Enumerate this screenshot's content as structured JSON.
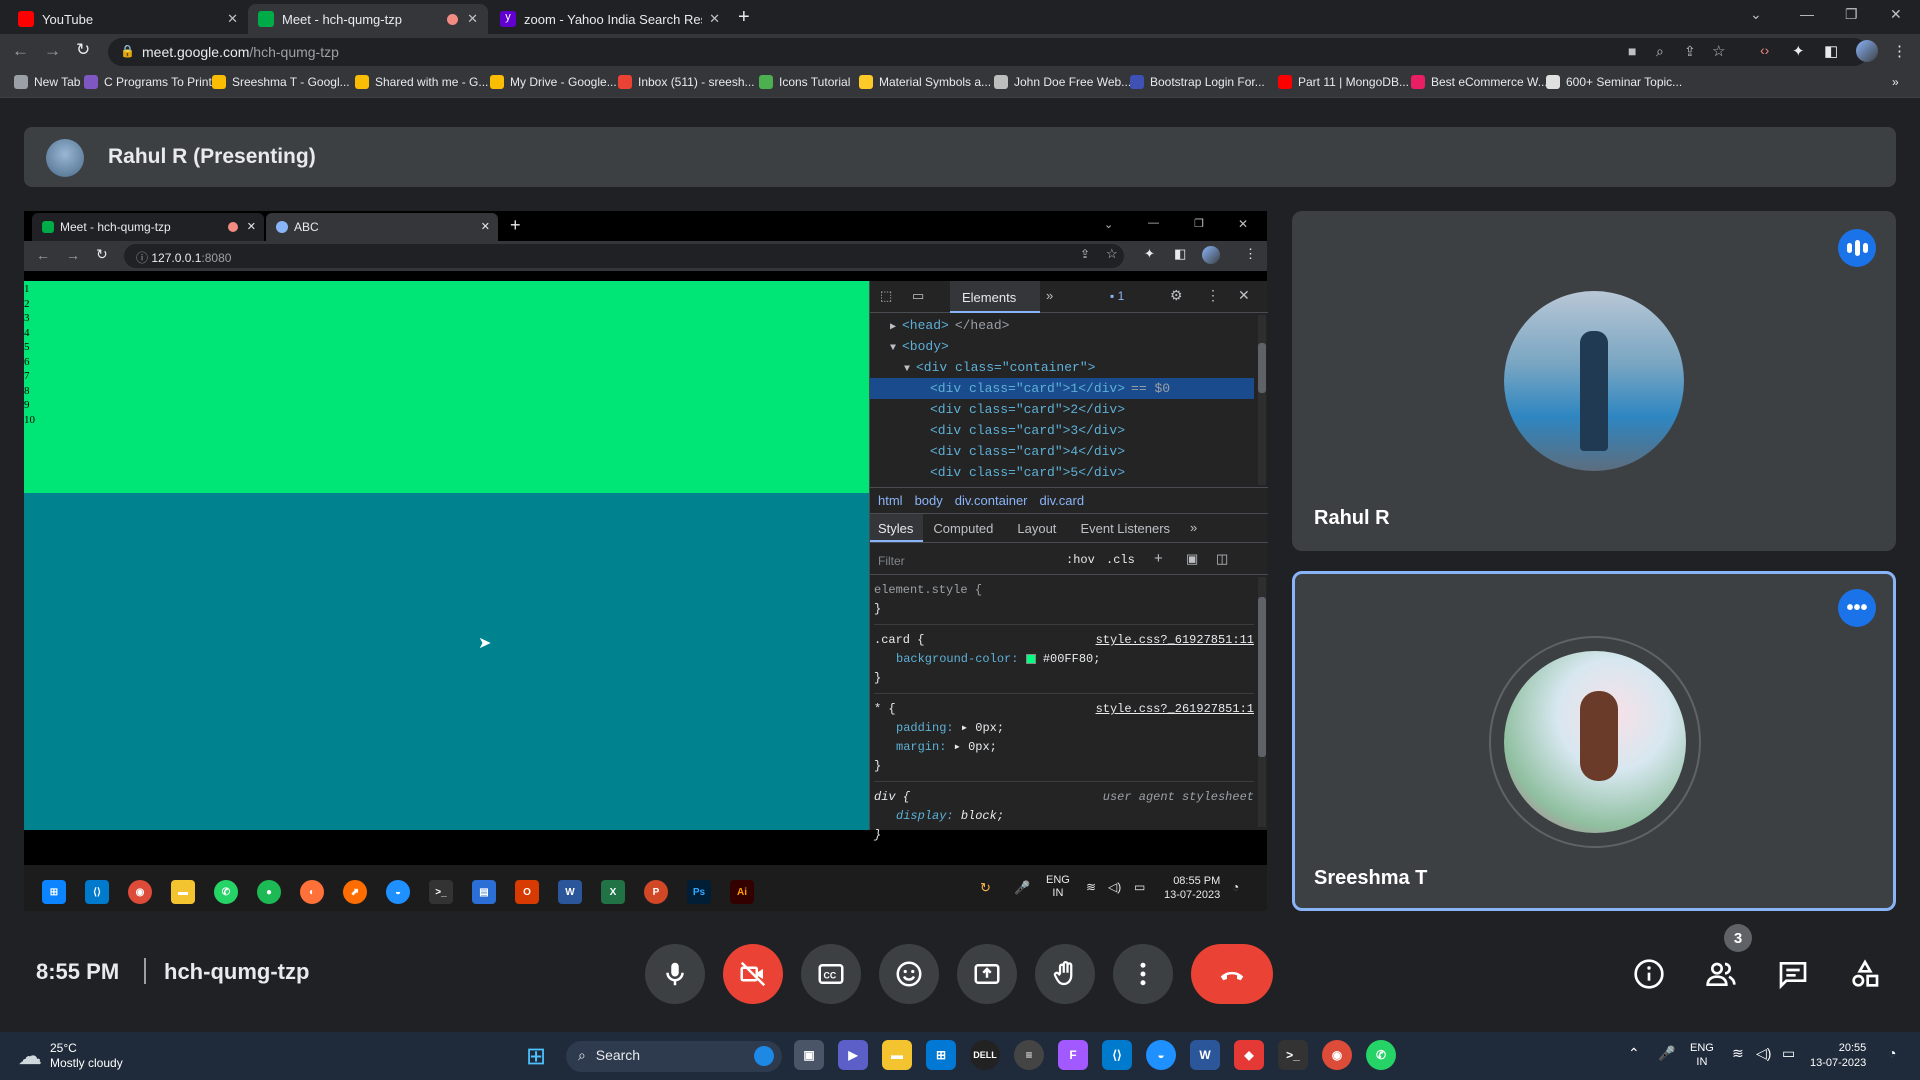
{
  "browser": {
    "tabs": [
      {
        "label": "YouTube",
        "color": "#ff0000"
      },
      {
        "label": "Meet - hch-qumg-tzp",
        "color": "#00ac47"
      },
      {
        "label": "zoom - Yahoo India Search Resul",
        "color": "#6001d2"
      }
    ],
    "url_host": "meet.google.com",
    "url_path": "/hch-qumg-tzp",
    "bookmarks": [
      {
        "label": "New Tab",
        "color": "#9aa0a6"
      },
      {
        "label": "C Programs To Print...",
        "color": "#7e57c2"
      },
      {
        "label": "Sreeshma T - Googl...",
        "color": "#fbbc04"
      },
      {
        "label": "Shared with me - G...",
        "color": "#fbbc04"
      },
      {
        "label": "My Drive - Google...",
        "color": "#fbbc04"
      },
      {
        "label": "Inbox (511) - sreesh...",
        "color": "#ea4335"
      },
      {
        "label": "Icons Tutorial",
        "color": "#4caf50"
      },
      {
        "label": "Material Symbols a...",
        "color": "#ffca28"
      },
      {
        "label": "John Doe Free Web...",
        "color": "#bdbdbd"
      },
      {
        "label": "Bootstrap Login For...",
        "color": "#3f51b5"
      },
      {
        "label": "Part 11 | MongoDB...",
        "color": "#ff0000"
      },
      {
        "label": "Best eCommerce W...",
        "color": "#e91e63"
      },
      {
        "label": "600+ Seminar Topic...",
        "color": "#e0e0e0"
      }
    ]
  },
  "meet": {
    "presenter_title": "Rahul R (Presenting)",
    "clock": "8:55 PM",
    "meeting_code": "hch-qumg-tzp",
    "participants_count": "3",
    "participants": [
      {
        "name": "Rahul R"
      },
      {
        "name": "Sreeshma T"
      }
    ]
  },
  "shared_screen": {
    "tabs": [
      {
        "label": "Meet - hch-qumg-tzp"
      },
      {
        "label": "ABC"
      }
    ],
    "url_host": "127.0.0.1",
    "url_port": ":8080",
    "page_lines": [
      "1",
      "2",
      "3",
      "4",
      "5",
      "6",
      "7",
      "8",
      "9",
      "10"
    ],
    "page_color_top": "#00e676",
    "page_color_bottom": "#00838f",
    "devtools": {
      "panel": "Elements",
      "issues": "1",
      "dom_lines": [
        {
          "indent": 0,
          "arrow": "▶",
          "text": "<head>",
          "tail": "</head>"
        },
        {
          "indent": 0,
          "arrow": "▼",
          "text": "<body>",
          "tail": ""
        },
        {
          "indent": 1,
          "arrow": "▼",
          "text": "<div class=\"container\">",
          "tail": ""
        },
        {
          "indent": 2,
          "arrow": "",
          "text": "<div class=\"card\">1</div>",
          "tail": "== $0"
        },
        {
          "indent": 2,
          "arrow": "",
          "text": "<div class=\"card\">2</div>",
          "tail": ""
        },
        {
          "indent": 2,
          "arrow": "",
          "text": "<div class=\"card\">3</div>",
          "tail": ""
        },
        {
          "indent": 2,
          "arrow": "",
          "text": "<div class=\"card\">4</div>",
          "tail": ""
        },
        {
          "indent": 2,
          "arrow": "",
          "text": "<div class=\"card\">5</div>",
          "tail": ""
        }
      ],
      "breadcrumbs": [
        "html",
        "body",
        "div.container",
        "div.card"
      ],
      "style_tabs": [
        "Styles",
        "Computed",
        "Layout",
        "Event Listeners"
      ],
      "filter_placeholder": "Filter",
      "hov": ":hov",
      "cls": ".cls",
      "rules": {
        "element_style": "element.style {",
        "card_selector": ".card {",
        "card_source": "style.css?_61927851:11",
        "card_prop": "background-color:",
        "card_value": "#00FF80;",
        "star_selector": "* {",
        "star_source": "style.css?_261927851:1",
        "padding_prop": "padding:",
        "padding_value": "0px;",
        "margin_prop": "margin:",
        "margin_value": "0px;",
        "div_selector": "div {",
        "div_source": "user agent stylesheet",
        "display_prop": "display:",
        "display_value": "block;",
        "close_brace": "}"
      }
    },
    "taskbar": {
      "lang_top": "ENG",
      "lang_bottom": "IN",
      "time": "08:55 PM",
      "date": "13-07-2023"
    }
  },
  "os_taskbar": {
    "weather_temp": "25°C",
    "weather_desc": "Mostly cloudy",
    "search_label": "Search",
    "lang_top": "ENG",
    "lang_bottom": "IN",
    "time": "20:55",
    "date": "13-07-2023"
  }
}
